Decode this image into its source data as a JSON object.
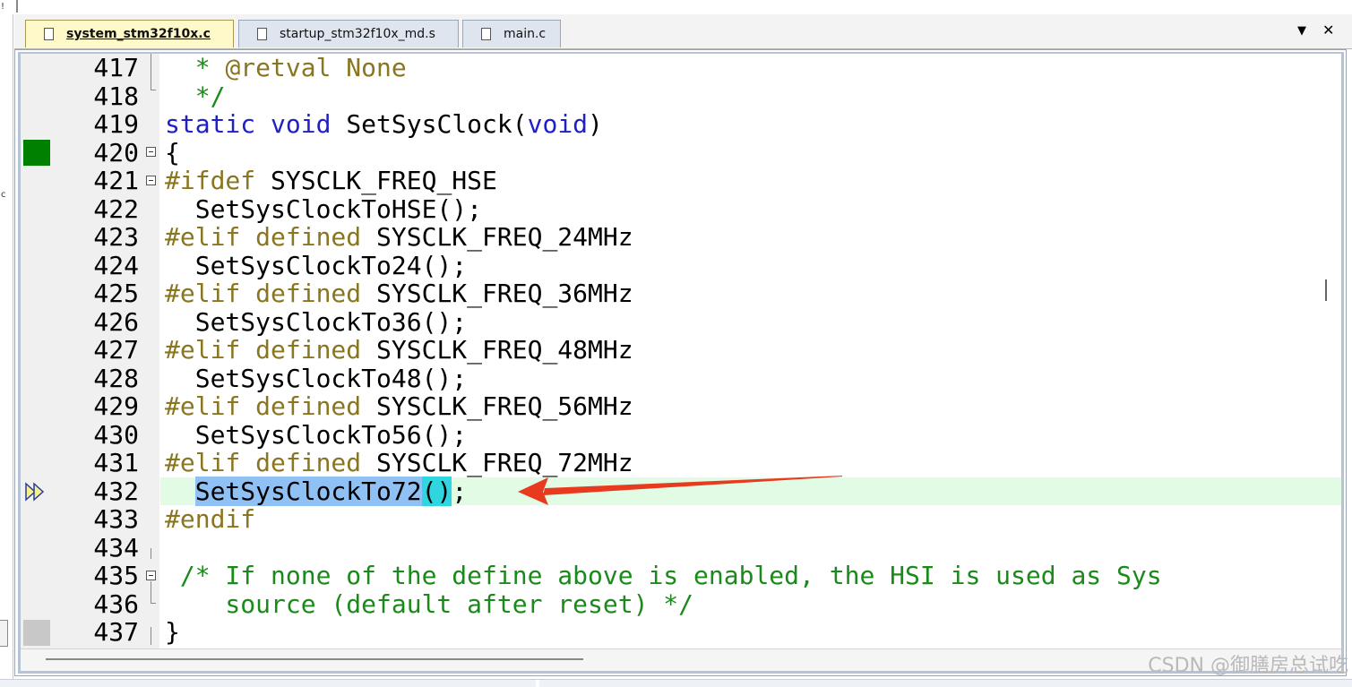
{
  "tabs": [
    {
      "label": "system_stm32f10x.c",
      "active": true
    },
    {
      "label": "startup_stm32f10x_md.s",
      "active": false
    },
    {
      "label": "main.c",
      "active": false
    }
  ],
  "tab_controls": {
    "dropdown": "▼",
    "close": "✕"
  },
  "lines": [
    {
      "num": "417"
    },
    {
      "num": "418"
    },
    {
      "num": "419"
    },
    {
      "num": "420"
    },
    {
      "num": "421"
    },
    {
      "num": "422"
    },
    {
      "num": "423"
    },
    {
      "num": "424"
    },
    {
      "num": "425"
    },
    {
      "num": "426"
    },
    {
      "num": "427"
    },
    {
      "num": "428"
    },
    {
      "num": "429"
    },
    {
      "num": "430"
    },
    {
      "num": "431"
    },
    {
      "num": "432"
    },
    {
      "num": "433"
    },
    {
      "num": "434"
    },
    {
      "num": "435"
    },
    {
      "num": "436"
    },
    {
      "num": "437"
    }
  ],
  "code": {
    "l417_a": "  * ",
    "l417_b": "@retval None",
    "l418": "  */",
    "l419_kw1": "static",
    "l419_kw2": "void",
    "l419_fn": "SetSysClock(",
    "l419_kw3": "void",
    "l419_end": ")",
    "l420": "{",
    "l421_pp": "#ifdef",
    "l421_rest": " SYSCLK_FREQ_HSE",
    "l422": "  SetSysClockToHSE();",
    "l423_pp": "#elif defined",
    "l423_rest": " SYSCLK_FREQ_24MHz",
    "l424": "  SetSysClockTo24();",
    "l425_pp": "#elif defined",
    "l425_rest": " SYSCLK_FREQ_36MHz",
    "l426": "  SetSysClockTo36();",
    "l427_pp": "#elif defined",
    "l427_rest": " SYSCLK_FREQ_48MHz",
    "l428": "  SetSysClockTo48();",
    "l429_pp": "#elif defined",
    "l429_rest": " SYSCLK_FREQ_56MHz",
    "l430": "  SetSysClockTo56();",
    "l431_pp": "#elif defined",
    "l431_rest": " SYSCLK_FREQ_72MHz",
    "l432_indent": "  ",
    "l432_sel": "SetSysClockTo72",
    "l432_brk": "()",
    "l432_end": ";",
    "l433": "#endif",
    "l435": " /* If none of the define above is enabled, the HSI is used as Sys",
    "l436": "    source (default after reset) */",
    "l437": "}"
  },
  "colors": {
    "keyword": "#2020c8",
    "preprocessor": "#8a7520",
    "comment": "#1a8a1a",
    "current_line": "#e1fbe4",
    "selection": "#8fc1f5",
    "bracket_match": "#2fd6e0",
    "breakpoint_marker": "#008000",
    "annotation_arrow": "#e83a1f"
  },
  "left_strip": {
    "top_char": "!",
    "mid_char": "c"
  },
  "watermark": "CSDN @御膳房总试吃"
}
